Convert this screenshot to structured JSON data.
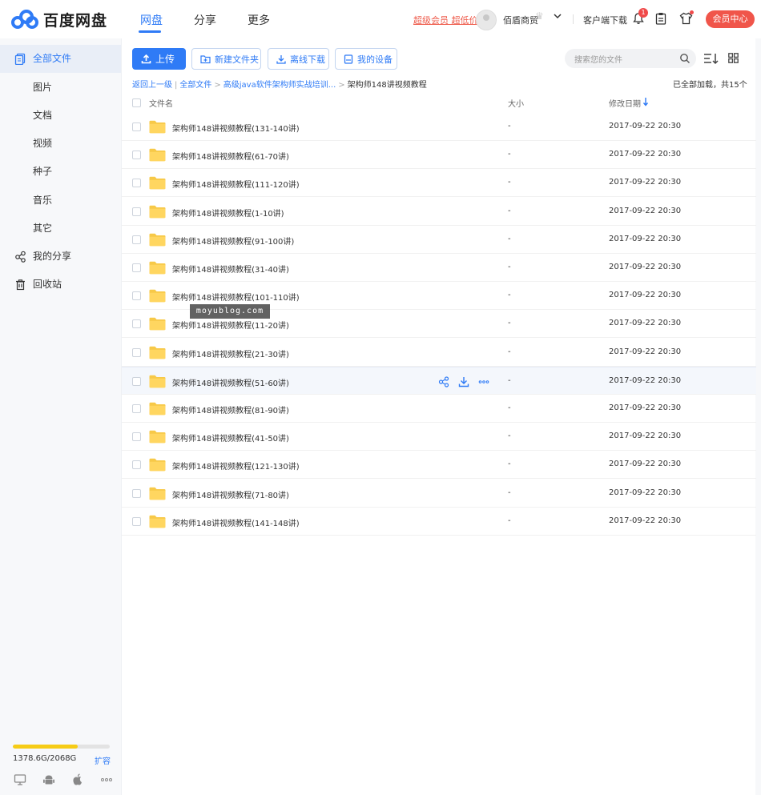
{
  "brand": {
    "name": "百度网盘",
    "accent": "#2f7bf6"
  },
  "nav": {
    "tabs": [
      "网盘",
      "分享",
      "更多"
    ],
    "active": 0
  },
  "header": {
    "vip_link": "超级会员 超低价",
    "username": "佰盾商贸",
    "client_download": "客户端下载",
    "notification_count": "1",
    "member_center": "会员中心"
  },
  "sidebar": {
    "items": [
      {
        "label": "全部文件",
        "icon": "files-icon"
      },
      {
        "label": "图片"
      },
      {
        "label": "文档"
      },
      {
        "label": "视频"
      },
      {
        "label": "种子"
      },
      {
        "label": "音乐"
      },
      {
        "label": "其它"
      },
      {
        "label": "我的分享",
        "icon": "share-icon"
      },
      {
        "label": "回收站",
        "icon": "trash-icon"
      }
    ],
    "storage": {
      "text": "1378.6G/2068G",
      "used_fraction": 0.667,
      "expand_label": "扩容"
    },
    "devices": [
      "desktop-icon",
      "android-icon",
      "apple-icon",
      "more-icon"
    ]
  },
  "toolbar": {
    "upload": "上传",
    "new_folder": "新建文件夹",
    "offline_download": "离线下载",
    "my_devices": "我的设备",
    "search_placeholder": "搜索您的文件"
  },
  "breadcrumb": {
    "back": "返回上一级",
    "root": "全部文件",
    "parent": "高级java软件架构师实战培训...",
    "current": "架构师148讲视频教程"
  },
  "status": {
    "loaded": "已全部加载，共15个"
  },
  "columns": {
    "name": "文件名",
    "size": "大小",
    "date": "修改日期"
  },
  "files": [
    {
      "name": "架构师148讲视频教程(131-140讲)",
      "size": "-",
      "date": "2017-09-22 20:30"
    },
    {
      "name": "架构师148讲视频教程(61-70讲)",
      "size": "-",
      "date": "2017-09-22 20:30"
    },
    {
      "name": "架构师148讲视频教程(111-120讲)",
      "size": "-",
      "date": "2017-09-22 20:30"
    },
    {
      "name": "架构师148讲视频教程(1-10讲)",
      "size": "-",
      "date": "2017-09-22 20:30"
    },
    {
      "name": "架构师148讲视频教程(91-100讲)",
      "size": "-",
      "date": "2017-09-22 20:30"
    },
    {
      "name": "架构师148讲视频教程(31-40讲)",
      "size": "-",
      "date": "2017-09-22 20:30"
    },
    {
      "name": "架构师148讲视频教程(101-110讲)",
      "size": "-",
      "date": "2017-09-22 20:30"
    },
    {
      "name": "架构师148讲视频教程(11-20讲)",
      "size": "-",
      "date": "2017-09-22 20:30"
    },
    {
      "name": "架构师148讲视频教程(21-30讲)",
      "size": "-",
      "date": "2017-09-22 20:30"
    },
    {
      "name": "架构师148讲视频教程(51-60讲)",
      "size": "-",
      "date": "2017-09-22 20:30",
      "hovered": true
    },
    {
      "name": "架构师148讲视频教程(81-90讲)",
      "size": "-",
      "date": "2017-09-22 20:30"
    },
    {
      "name": "架构师148讲视频教程(41-50讲)",
      "size": "-",
      "date": "2017-09-22 20:30"
    },
    {
      "name": "架构师148讲视频教程(121-130讲)",
      "size": "-",
      "date": "2017-09-22 20:30"
    },
    {
      "name": "架构师148讲视频教程(71-80讲)",
      "size": "-",
      "date": "2017-09-22 20:30"
    },
    {
      "name": "架构师148讲视频教程(141-148讲)",
      "size": "-",
      "date": "2017-09-22 20:30"
    }
  ],
  "watermark": "moyublog.com"
}
